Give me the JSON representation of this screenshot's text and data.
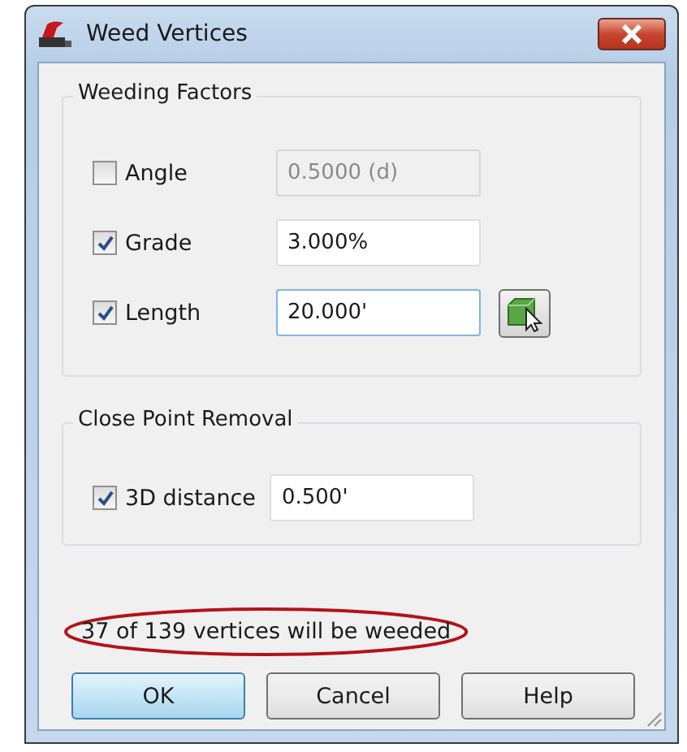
{
  "window": {
    "title": "Weed Vertices"
  },
  "groups": [
    {
      "title": "Weeding Factors",
      "rows": [
        {
          "label": "Angle",
          "checked": false,
          "value": "0.5000 (d)",
          "disabled": true,
          "focused": false,
          "pick_button": false
        },
        {
          "label": "Grade",
          "checked": true,
          "value": "3.000%",
          "disabled": false,
          "focused": false,
          "pick_button": false
        },
        {
          "label": "Length",
          "checked": true,
          "value": "20.000'",
          "disabled": false,
          "focused": true,
          "pick_button": true
        }
      ]
    },
    {
      "title": "Close Point Removal",
      "rows": [
        {
          "label": "3D distance",
          "checked": true,
          "value": "0.500'",
          "disabled": false,
          "focused": false,
          "pick_button": false
        }
      ]
    }
  ],
  "status": {
    "text": "37 of 139 vertices will be weeded",
    "circled": true
  },
  "buttons": [
    {
      "label": "OK",
      "default": true
    },
    {
      "label": "Cancel",
      "default": false
    },
    {
      "label": "Help",
      "default": false
    }
  ]
}
